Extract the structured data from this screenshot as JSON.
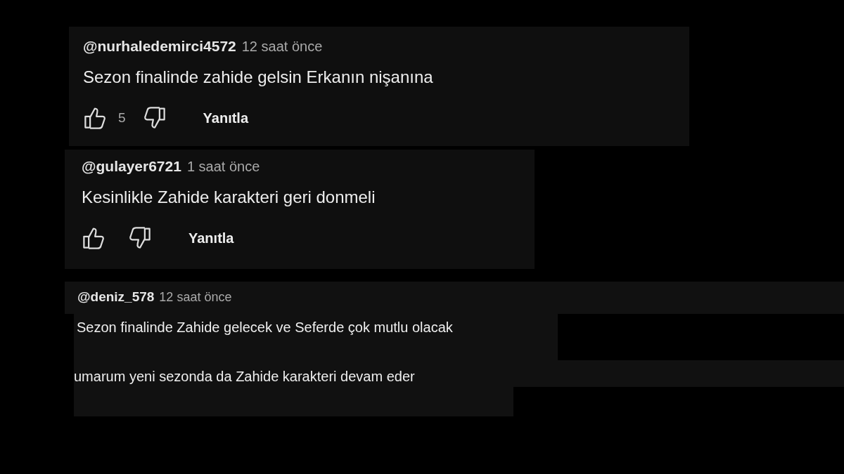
{
  "comments": [
    {
      "kind": "with_actions",
      "author": "@nurhaledemirci4572",
      "time": "12 saat önce",
      "lines": [
        "Sezon finalinde zahide gelsin Erkanın nişanına"
      ],
      "like_count": "5",
      "reply": "Yanıtla"
    },
    {
      "kind": "with_actions",
      "author": "@gulayer6721",
      "time": "1 saat önce",
      "lines": [
        "Kesinlikle Zahide karakteri geri donmeli"
      ],
      "reply": "Yanıtla"
    },
    {
      "kind": "cutout",
      "author": "@deniz_578",
      "time": "12 saat önce",
      "lines": [
        "Sezon finalinde Zahide gelecek ve Seferde çok mutlu olacak",
        "umarum yeni sezonda da Zahide karakteri devam eder"
      ]
    }
  ]
}
